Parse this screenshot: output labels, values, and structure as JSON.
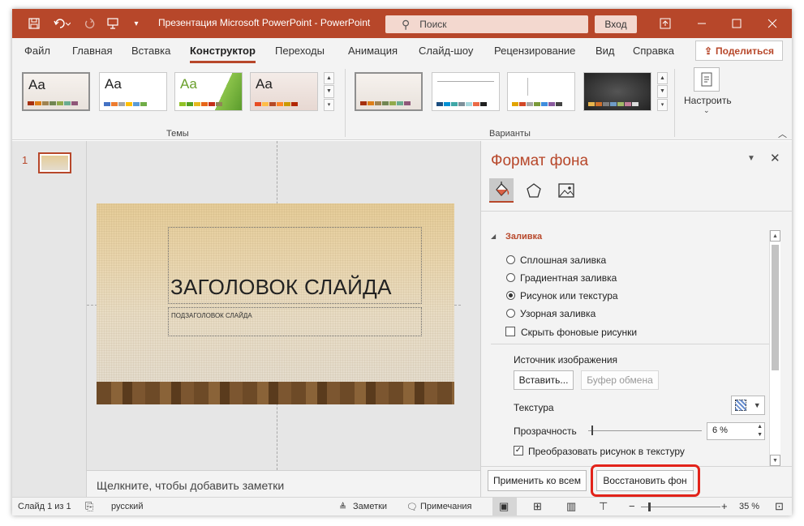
{
  "titlebar": {
    "title": "Презентация Microsoft PowerPoint  -  PowerPoint",
    "search_placeholder": "Поиск",
    "signin": "Вход",
    "bg": "#b7472a"
  },
  "menu": {
    "tabs": [
      "Файл",
      "Главная",
      "Вставка",
      "Конструктор",
      "Переходы",
      "Анимация",
      "Слайд-шоу",
      "Рецензирование",
      "Вид",
      "Справка"
    ],
    "active": "Конструктор",
    "share": "Поделиться"
  },
  "ribbon": {
    "themes_label": "Темы",
    "variants_label": "Варианты",
    "customize_label": "Настроить",
    "theme_sample": "Aa"
  },
  "thumbs": {
    "slide_number": "1"
  },
  "slide": {
    "title": "ЗАГОЛОВОК СЛАЙДА",
    "subtitle": "ПОДЗАГОЛОВОК СЛАЙДА"
  },
  "notes": {
    "placeholder": "Щелкните, чтобы добавить заметки"
  },
  "format_pane": {
    "title": "Формат фона",
    "section": "Заливка",
    "options": [
      "Сплошная заливка",
      "Градиентная заливка",
      "Рисунок или текстура",
      "Узорная заливка"
    ],
    "selected_option": "Рисунок или текстура",
    "hide_bg": "Скрыть фоновые рисунки",
    "image_source": "Источник изображения",
    "insert_btn": "Вставить...",
    "clipboard_btn": "Буфер обмена",
    "texture": "Текстура",
    "transparency": "Прозрачность",
    "transparency_value": "6 %",
    "tile": "Преобразовать рисунок в текстуру",
    "apply_all": "Применить ко всем",
    "reset": "Восстановить фон"
  },
  "status": {
    "slide": "Слайд 1 из 1",
    "lang": "русский",
    "notes": "Заметки",
    "comments": "Примечания",
    "zoom": "35 %"
  }
}
